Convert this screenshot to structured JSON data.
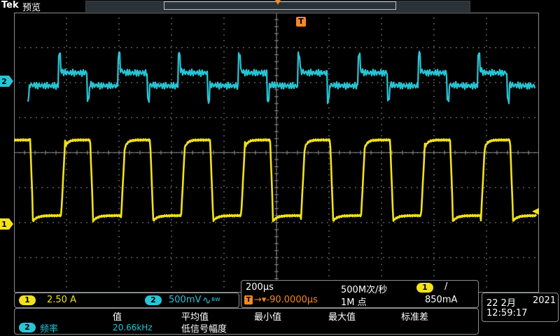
{
  "header": {
    "brand": "Tek",
    "title": "预览"
  },
  "colors": {
    "ch1": "#f2e21a",
    "ch2": "#26c6d6",
    "trigger": "#f5891f",
    "grid": "#8c8c8c"
  },
  "markers": {
    "ch1": "1",
    "ch2": "2",
    "trigger": "T"
  },
  "channels": {
    "ch1_badge": "1",
    "ch1_scale": "2.50 A",
    "ch2_badge": "2",
    "ch2_scale": "500mV",
    "ch2_bw_symbol": "∿",
    "ch2_bw_suffix": "ʙw"
  },
  "timebase": {
    "time_div": "200µs",
    "sample_rate": "500M次/秒",
    "trigger_source_badge": "1",
    "trigger_slope": "/",
    "trigger_icon": "T",
    "trigger_position": "→▾-90.0000µs",
    "record_length": "1M 点",
    "trigger_level": "850mA"
  },
  "datetime": {
    "date": "22 2月",
    "year": "2021",
    "time": "12:59:17"
  },
  "measurements": {
    "headers": [
      "值",
      "平均值",
      "最小值",
      "最大值",
      "标准差"
    ],
    "badge": "2",
    "name": "频率",
    "value": "20.66kHz",
    "status": "低信号幅度"
  }
}
